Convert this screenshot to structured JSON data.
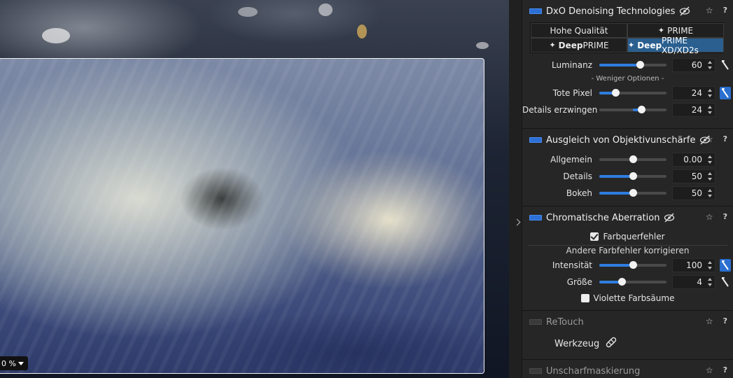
{
  "viewer": {
    "zoom_label": "0 %"
  },
  "panel": {
    "denoising": {
      "title": "DxO Denoising Technologies",
      "quality_options": [
        {
          "prefix": "",
          "bold": "",
          "label": "Hohe Qualität",
          "active": false
        },
        {
          "prefix": "✦",
          "bold": "",
          "label": "PRIME",
          "active": false
        },
        {
          "prefix": "✦",
          "bold": "Deep",
          "label": "PRIME",
          "active": false
        },
        {
          "prefix": "✦",
          "bold": "Deep",
          "label": "PRIME XD/XD2s",
          "active": true
        }
      ],
      "luminanz": {
        "label": "Luminanz",
        "value": "60",
        "level": 0.6
      },
      "fewer_options": "- Weniger Optionen -",
      "tote_pixel": {
        "label": "Tote Pixel",
        "value": "24",
        "level": 0.24
      },
      "details_erzwingen": {
        "label": "Details erzwingen",
        "value": "24",
        "level": 0.62
      }
    },
    "lens_blur": {
      "title": "Ausgleich von Objektivunschärfe",
      "allgemein": {
        "label": "Allgemein",
        "value": "0.00",
        "level": 0.5
      },
      "details": {
        "label": "Details",
        "value": "50",
        "level": 0.5
      },
      "bokeh": {
        "label": "Bokeh",
        "value": "50",
        "level": 0.5
      }
    },
    "chromatic": {
      "title": "Chromatische Aberration",
      "farbquerfehler": "Farbquerfehler",
      "other_heading": "Andere Farbfehler korrigieren",
      "intensitaet": {
        "label": "Intensität",
        "value": "100",
        "level": 0.5
      },
      "groesse": {
        "label": "Größe",
        "value": "4",
        "level": 0.33
      },
      "violette": "Violette Farbsäume"
    },
    "retouch": {
      "title": "ReTouch",
      "tool_label": "Werkzeug"
    },
    "unsharp": {
      "title": "Unscharfmaskierung"
    },
    "icons": {
      "star": "☆",
      "help": "?"
    }
  },
  "colors": {
    "accent": "#2f7de0",
    "panel_bg": "#262626",
    "active_quality": "#2a5f8f"
  }
}
